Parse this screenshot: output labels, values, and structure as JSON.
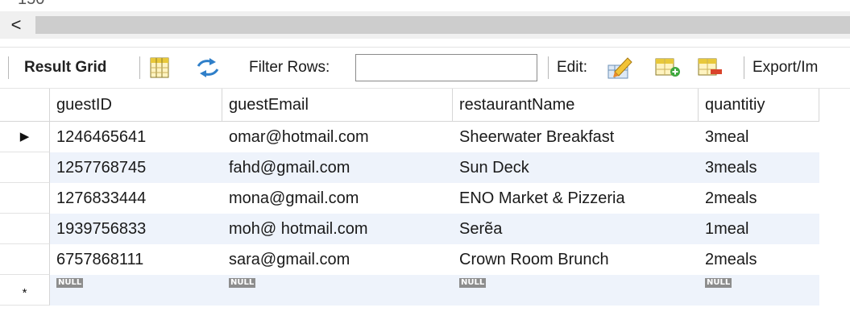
{
  "top_cut_text": "150",
  "scroll": {
    "left_arrow_icon": "chevron-left-icon",
    "left_arrow_glyph": "<"
  },
  "toolbar": {
    "result_grid_label": "Result Grid",
    "filter_label": "Filter Rows:",
    "filter_value": "",
    "edit_label": "Edit:",
    "export_label": "Export/Im"
  },
  "grid": {
    "columns": [
      "guestID",
      "guestEmail",
      "restaurantName",
      "quantitiy"
    ],
    "rows": [
      {
        "marker": "▶",
        "cells": [
          "1246465641",
          "omar@hotmail.com",
          "Sheerwater Breakfast",
          "3meal"
        ]
      },
      {
        "marker": "",
        "cells": [
          "1257768745",
          "fahd@gmail.com",
          "Sun Deck",
          "3meals"
        ]
      },
      {
        "marker": "",
        "cells": [
          "1276833444",
          "mona@gmail.com",
          "ENO Market & Pizzeria",
          "2meals"
        ]
      },
      {
        "marker": "",
        "cells": [
          "1939756833",
          "moh@ hotmail.com",
          "Serẽa",
          "1meal"
        ]
      },
      {
        "marker": "",
        "cells": [
          "6757868111",
          "sara@gmail.com",
          "Crown Room Brunch",
          "2meals"
        ]
      }
    ],
    "new_row": {
      "marker": "*",
      "cells": [
        "NULL",
        "NULL",
        "NULL",
        "NULL"
      ]
    }
  },
  "colors": {
    "row_alt": "#eef3fb",
    "null_tag": "#8d8d8d",
    "refresh_blue": "#2f7fc9"
  }
}
